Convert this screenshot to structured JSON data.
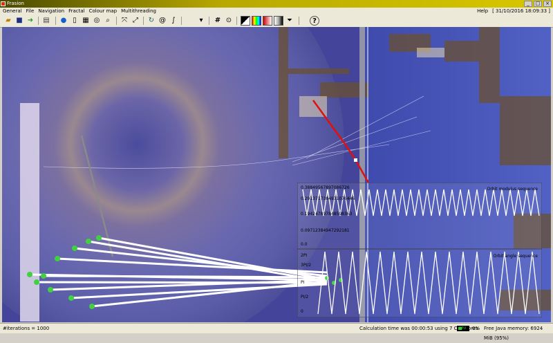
{
  "window": {
    "title": "Frasion"
  },
  "menu": {
    "items": [
      "General",
      "File",
      "Navigation",
      "Fractal",
      "Colour map",
      "Multithreading"
    ],
    "help": "Help",
    "date": "[ 31/10/2016 18:09:33 ]"
  },
  "toolbar": {
    "icons": [
      "open-folder-icon",
      "save-icon",
      "export-icon",
      "print-icon",
      "info-icon",
      "document-icon",
      "grid-icon",
      "target-icon",
      "zoom-icon",
      "fit-icon",
      "expand-icon",
      "rotate-icon",
      "spiral-icon",
      "curve-icon",
      "bookmark-icon",
      "hash-icon",
      "palette-icon",
      "gradient-icon",
      "colour-icon",
      "swatch-icon",
      "filter-icon",
      "help-icon"
    ]
  },
  "plot": {
    "modulus_title": "Orbit modulus sequence",
    "angle_title": "Orbit angle sequence",
    "modulus_ticks": [
      "0.38849567897086726",
      "0.2913717384931076446",
      "0.194247897848598363",
      "0.09712384947292181",
      "0.0"
    ],
    "angle_ticks": [
      "2PI",
      "3PI/2",
      "PI",
      "PI/2",
      "0"
    ]
  },
  "status": {
    "iterations": "#iterations = 1000",
    "calc_time": "Calculation time was 00:00:53 using 7 CPU cores",
    "cpu_label": "CPU",
    "cpu_percent": "0%",
    "memory": "Free Java memory: 6924 MiB (95%)"
  },
  "colors": {
    "background": "#3a3f8e",
    "accent": "#e03000",
    "orbit_point": "#40d040"
  }
}
